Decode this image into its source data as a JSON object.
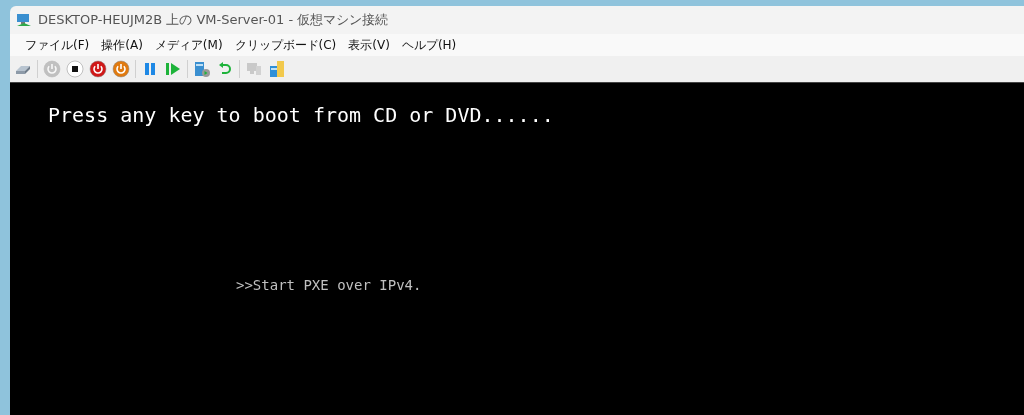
{
  "window": {
    "title": "DESKTOP-HEUJM2B 上の VM-Server-01  - 仮想マシン接続"
  },
  "menu": [
    "ファイル(F)",
    "操作(A)",
    "メディア(M)",
    "クリップボード(C)",
    "表示(V)",
    "ヘルプ(H)"
  ],
  "toolbar": [
    {
      "kind": "ctrl-alt-del",
      "disabled": false
    },
    {
      "kind": "sep"
    },
    {
      "kind": "start",
      "disabled": true
    },
    {
      "kind": "turn-off",
      "disabled": false
    },
    {
      "kind": "shutdown",
      "disabled": false
    },
    {
      "kind": "save",
      "disabled": false
    },
    {
      "kind": "sep"
    },
    {
      "kind": "pause",
      "disabled": false
    },
    {
      "kind": "resume",
      "disabled": false
    },
    {
      "kind": "sep"
    },
    {
      "kind": "checkpoint",
      "disabled": false
    },
    {
      "kind": "revert",
      "disabled": false
    },
    {
      "kind": "sep"
    },
    {
      "kind": "session",
      "disabled": true
    },
    {
      "kind": "share",
      "disabled": false
    }
  ],
  "console": {
    "lines": [
      {
        "kind": "boot",
        "text": "Press any key to boot from CD or DVD......"
      },
      {
        "kind": "pxe",
        "text": ">>Start PXE over IPv4."
      }
    ]
  }
}
